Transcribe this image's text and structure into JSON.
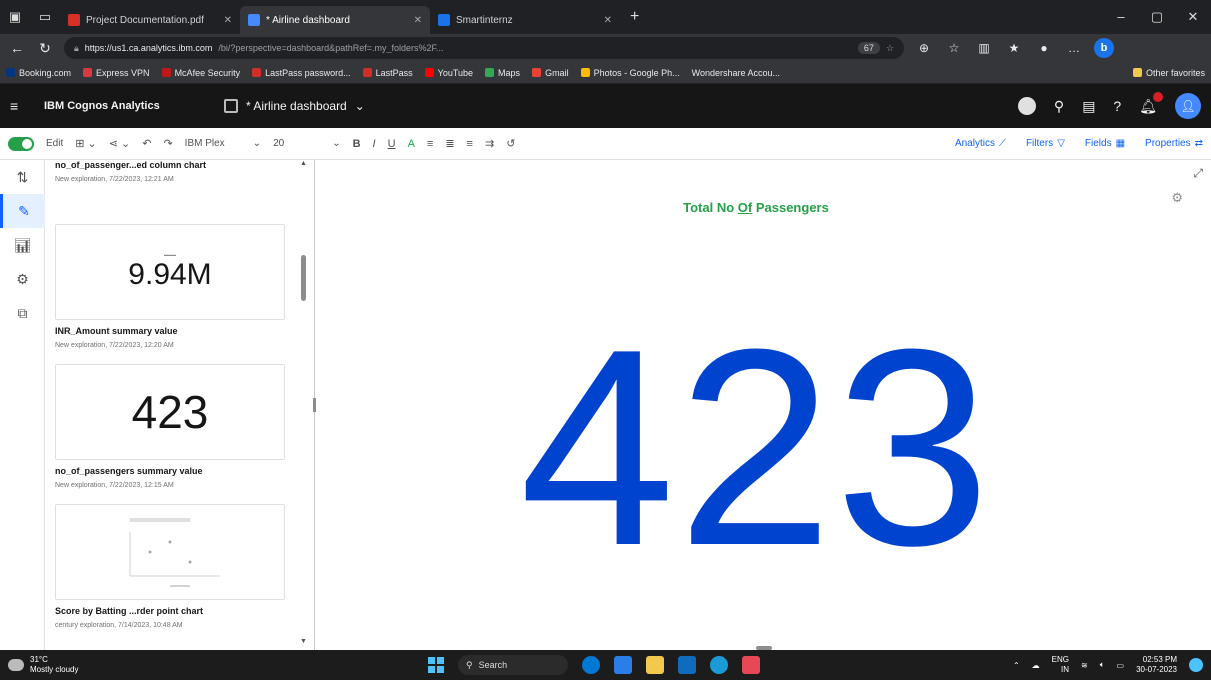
{
  "browser": {
    "tabs": [
      {
        "title": "Project Documentation.pdf",
        "icon_color": "#d93025",
        "active": false
      },
      {
        "title": "* Airline dashboard",
        "icon_color": "#4589ff",
        "active": true
      },
      {
        "title": "Smartinternz",
        "icon_color": "#1a73e8",
        "active": false
      }
    ],
    "url_host": "https://us1.ca.analytics.ibm.com",
    "url_rest": "/bi/?perspective=dashboard&pathRef=.my_folders%2F...",
    "zoom": "67",
    "bookmarks": [
      {
        "label": "Booking.com",
        "color": "#003580"
      },
      {
        "label": "Express VPN",
        "color": "#da3940"
      },
      {
        "label": "McAfee Security",
        "color": "#c01818"
      },
      {
        "label": "LastPass password...",
        "color": "#d32d27"
      },
      {
        "label": "LastPass",
        "color": "#d32d27"
      },
      {
        "label": "YouTube",
        "color": "#ff0000"
      },
      {
        "label": "Maps",
        "color": "#34a853"
      },
      {
        "label": "Gmail",
        "color": "#ea4335"
      },
      {
        "label": "Photos - Google Ph...",
        "color": "#fbbc04"
      },
      {
        "label": "Wondershare Accou...",
        "color": "#5f6368"
      }
    ],
    "other_favorites": "Other favorites"
  },
  "cognos": {
    "product": "IBM Cognos Analytics",
    "dashboard_name": "* Airline dashboard"
  },
  "toolbar": {
    "edit_label": "Edit",
    "font_family": "IBM Plex",
    "font_size": "20",
    "analytics_label": "Analytics",
    "filters_label": "Filters",
    "fields_label": "Fields",
    "properties_label": "Properties"
  },
  "assets": [
    {
      "title": "no_of_passenger...ed column chart",
      "subtitle": "New exploration, 7/22/2023, 12:21 AM"
    },
    {
      "value": "9.94M",
      "title": "INR_Amount summary value",
      "subtitle": "New exploration, 7/22/2023, 12:20 AM"
    },
    {
      "value": "423",
      "title": "no_of_passengers summary value",
      "subtitle": "New exploration, 7/22/2023, 12:15 AM"
    },
    {
      "title": "Score by Batting ...rder point chart",
      "subtitle": "century exploration, 7/14/2023, 10:48 AM"
    }
  ],
  "widget": {
    "title_pre": "Total No ",
    "title_underlined": "Of",
    "title_post": " Passengers",
    "value": "423"
  },
  "taskbar": {
    "temperature": "31°C",
    "weather": "Mostly cloudy",
    "search": "Search",
    "lang_top": "ENG",
    "lang_bottom": "IN",
    "time": "02:53 PM",
    "date": "30-07-2023"
  },
  "colors": {
    "kpi_blue": "#0043ce",
    "title_green": "#24a148",
    "accent_blue": "#0f62fe"
  }
}
